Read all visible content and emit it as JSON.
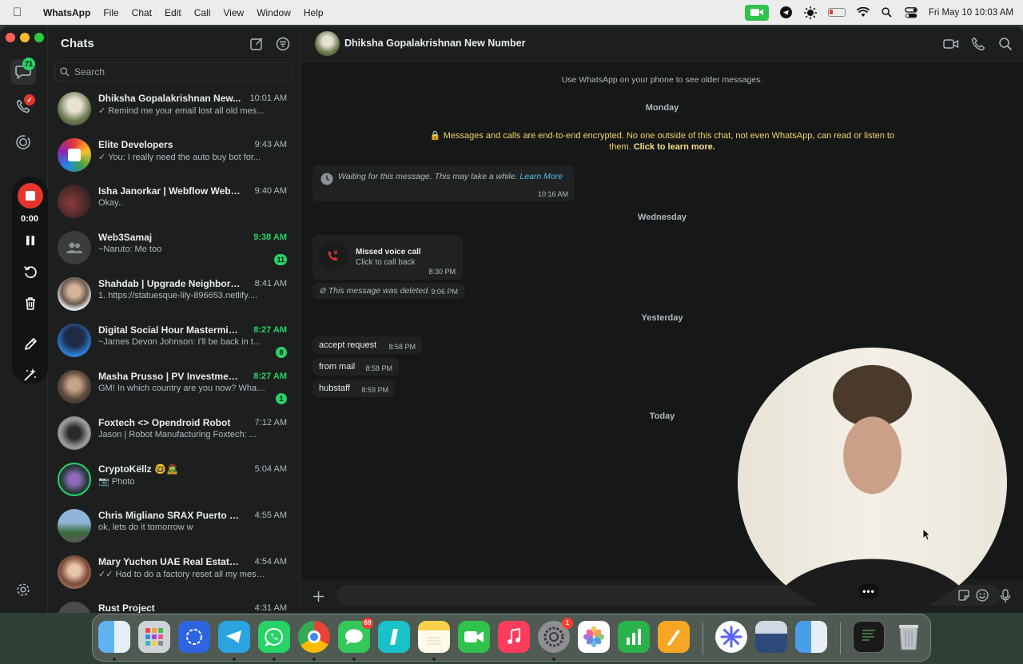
{
  "menubar": {
    "app_name": "WhatsApp",
    "menus": [
      "File",
      "Chat",
      "Edit",
      "Call",
      "View",
      "Window",
      "Help"
    ],
    "datetime": "Fri May 10  10:03 AM"
  },
  "rail": {
    "chats_badge": "71",
    "recorder_time": "0:00"
  },
  "chatlist": {
    "title": "Chats",
    "search_placeholder": "Search",
    "chats": [
      {
        "name": "Dhiksha Gopalakrishnan New...",
        "time": "10:01 AM",
        "preview": "✓ Remind me your email lost all old mes...",
        "unread": false,
        "count": ""
      },
      {
        "name": "Elite Developers",
        "time": "9:43 AM",
        "preview": "✓ You: I really need the auto buy bot for...",
        "unread": false,
        "count": ""
      },
      {
        "name": "Isha Janorkar | Webflow Web D...",
        "time": "9:40 AM",
        "preview": "Okay..",
        "unread": false,
        "count": ""
      },
      {
        "name": "Web3Samaj",
        "time": "9:38 AM",
        "preview": "~Naruto: Me too",
        "unread": true,
        "count": "11"
      },
      {
        "name": "Shahdab | Upgrade Neighborgo...",
        "time": "8:41 AM",
        "preview": "1. https://statuesque-lily-896653.netlify....",
        "unread": false,
        "count": ""
      },
      {
        "name": "Digital Social Hour Mastermind...",
        "time": "8:27 AM",
        "preview": "~James Devon Johnson: I'll be back in t...",
        "unread": true,
        "count": "8"
      },
      {
        "name": "Masha Prusso | PV Investments...",
        "time": "8:27 AM",
        "preview": "GM! In which country are you now? What...",
        "unread": true,
        "count": "1"
      },
      {
        "name": "Foxtech <> Opendroid Robot",
        "time": "7:12 AM",
        "preview": "Jason | Robot Manufacturing Foxtech: ...",
        "unread": false,
        "count": ""
      },
      {
        "name": "CryptoKëllz 🤓🧟",
        "time": "5:04 AM",
        "preview": "📷 Photo",
        "unread": false,
        "count": ""
      },
      {
        "name": "Chris Migliano SRAX Puerto Ric...",
        "time": "4:55 AM",
        "preview": "ok, lets do it tomorrow w",
        "unread": false,
        "count": ""
      },
      {
        "name": "Mary Yuchen UAE Real Estate :)...",
        "time": "4:54 AM",
        "preview": "✓✓ Had to do a factory reset all my mess...",
        "unread": false,
        "count": ""
      },
      {
        "name": "Rust Project",
        "time": "4:31 AM",
        "preview": "",
        "unread": false,
        "count": ""
      }
    ]
  },
  "conversation": {
    "title": "Dhiksha Gopalakrishnan New Number",
    "older_notice": "Use WhatsApp on your phone to see older messages.",
    "days": {
      "d1": "Monday",
      "d2": "Wednesday",
      "d3": "Yesterday",
      "d4": "Today"
    },
    "encryption_text": "Messages and calls are end-to-end encrypted. No one outside of this chat, not even WhatsApp, can read or listen to them.",
    "encryption_link": "Click to learn more.",
    "waiting": {
      "text": "Waiting for this message. This may take a while.",
      "link": "Learn More",
      "time": "10:16 AM"
    },
    "missed_call": {
      "title": "Missed voice call",
      "subtitle": "Click to call back",
      "time": "8:30 PM"
    },
    "deleted": {
      "text": "This message was deleted.",
      "time": "9:06 PM"
    },
    "messages": [
      {
        "text": "accept request",
        "time": "8:58 PM"
      },
      {
        "text": "from mail",
        "time": "8:58 PM"
      },
      {
        "text": "hubstaff",
        "time": "8:59 PM"
      }
    ],
    "composer_value": ""
  },
  "dock": {
    "messages_badge": "69",
    "settings_badge": "1"
  },
  "colors": {
    "accent": "#25d366",
    "record": "#e5352d",
    "encryption": "#f2d36a"
  }
}
